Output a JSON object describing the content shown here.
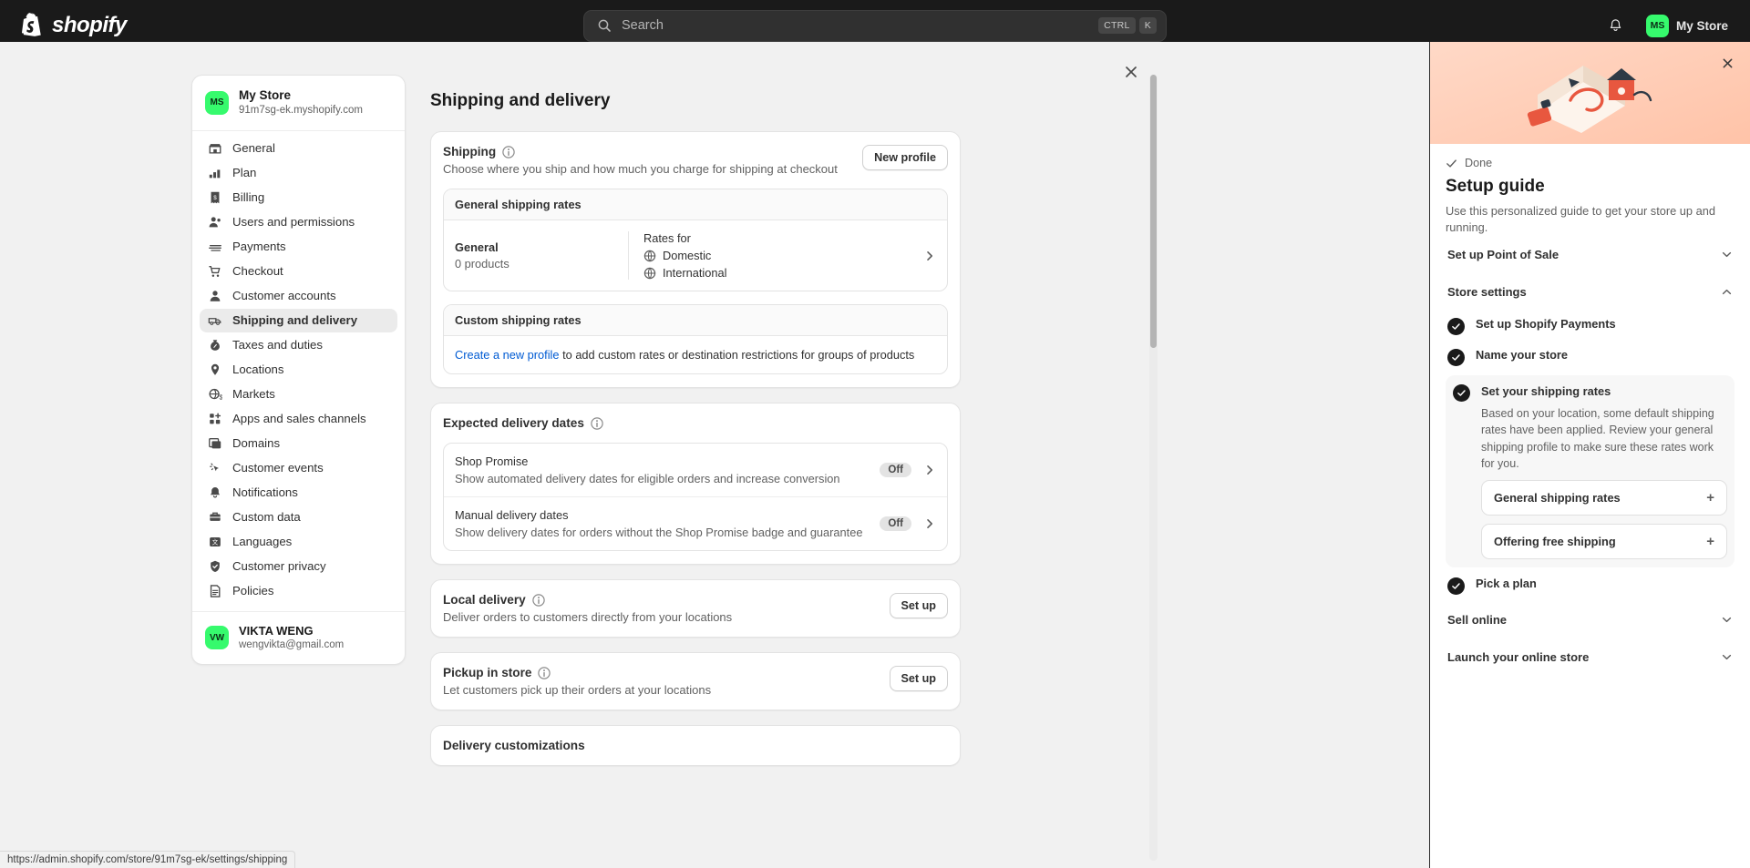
{
  "topbar": {
    "logo_text": "shopify",
    "search_placeholder": "Search",
    "kbd_ctrl": "CTRL",
    "kbd_k": "K",
    "store_initials": "MS",
    "store_name": "My Store"
  },
  "settings_nav": {
    "store_initials": "MS",
    "store_name": "My Store",
    "store_domain": "91m7sg-ek.myshopify.com",
    "items": [
      {
        "label": "General",
        "icon": "store-icon",
        "active": false
      },
      {
        "label": "Plan",
        "icon": "chart-icon",
        "active": false
      },
      {
        "label": "Billing",
        "icon": "receipt-icon",
        "active": false
      },
      {
        "label": "Users and permissions",
        "icon": "users-icon",
        "active": false
      },
      {
        "label": "Payments",
        "icon": "payment-icon",
        "active": false
      },
      {
        "label": "Checkout",
        "icon": "cart-icon",
        "active": false
      },
      {
        "label": "Customer accounts",
        "icon": "person-icon",
        "active": false
      },
      {
        "label": "Shipping and delivery",
        "icon": "truck-icon",
        "active": true
      },
      {
        "label": "Taxes and duties",
        "icon": "tax-icon",
        "active": false
      },
      {
        "label": "Locations",
        "icon": "pin-icon",
        "active": false
      },
      {
        "label": "Markets",
        "icon": "globe-money-icon",
        "active": false
      },
      {
        "label": "Apps and sales channels",
        "icon": "apps-icon",
        "active": false
      },
      {
        "label": "Domains",
        "icon": "domains-icon",
        "active": false
      },
      {
        "label": "Customer events",
        "icon": "cursor-icon",
        "active": false
      },
      {
        "label": "Notifications",
        "icon": "bell-icon",
        "active": false
      },
      {
        "label": "Custom data",
        "icon": "database-icon",
        "active": false
      },
      {
        "label": "Languages",
        "icon": "language-icon",
        "active": false
      },
      {
        "label": "Customer privacy",
        "icon": "privacy-icon",
        "active": false
      },
      {
        "label": "Policies",
        "icon": "policies-icon",
        "active": false
      }
    ],
    "user_initials": "VW",
    "user_name": "VIKTA WENG",
    "user_email": "wengvikta@gmail.com"
  },
  "settings_page": {
    "title": "Shipping and delivery",
    "shipping": {
      "title": "Shipping",
      "subtitle": "Choose where you ship and how much you charge for shipping at checkout",
      "new_profile_button": "New profile",
      "general_rates_header": "General shipping rates",
      "profile_name": "General",
      "profile_products": "0 products",
      "rates_for_label": "Rates for",
      "rate_domestic": "Domestic",
      "rate_international": "International",
      "custom_rates_header": "Custom shipping rates",
      "custom_link": "Create a new profile",
      "custom_rest": " to add custom rates or destination restrictions for groups of products"
    },
    "expected_delivery": {
      "title": "Expected delivery dates",
      "rows": [
        {
          "title": "Shop Promise",
          "desc": "Show automated delivery dates for eligible orders and increase conversion",
          "status": "Off"
        },
        {
          "title": "Manual delivery dates",
          "desc": "Show delivery dates for orders without the Shop Promise badge and guarantee",
          "status": "Off"
        }
      ]
    },
    "local_delivery": {
      "title": "Local delivery",
      "desc": "Deliver orders to customers directly from your locations",
      "button": "Set up"
    },
    "pickup_in_store": {
      "title": "Pickup in store",
      "desc": "Let customers pick up their orders at your locations",
      "button": "Set up"
    },
    "delivery_customizations": {
      "title": "Delivery customizations"
    }
  },
  "setup_guide": {
    "done_label": "Done",
    "title": "Setup guide",
    "description": "Use this personalized guide to get your store up and running.",
    "sections": [
      {
        "label": "Set up Point of Sale",
        "expanded": false
      },
      {
        "label": "Store settings",
        "expanded": true
      },
      {
        "label": "Sell online",
        "expanded": false
      },
      {
        "label": "Launch your online store",
        "expanded": false
      }
    ],
    "tasks": [
      {
        "label": "Set up Shopify Payments",
        "done": true,
        "active": false
      },
      {
        "label": "Name your store",
        "done": true,
        "active": false
      },
      {
        "label": "Set your shipping rates",
        "done": true,
        "active": true,
        "body": "Based on your location, some default shipping rates have been applied. Review your general shipping profile to make sure these rates work for you.",
        "tiles": [
          {
            "label": "General shipping rates"
          },
          {
            "label": "Offering free shipping"
          }
        ]
      },
      {
        "label": "Pick a plan",
        "done": true,
        "active": false
      }
    ]
  },
  "status_bar": {
    "url": "https://admin.shopify.com/store/91m7sg-ek/settings/shipping"
  },
  "colors": {
    "brand_green": "#36fa6d",
    "link_blue": "#005bd3",
    "hero_peach": "#ffc3a8"
  }
}
